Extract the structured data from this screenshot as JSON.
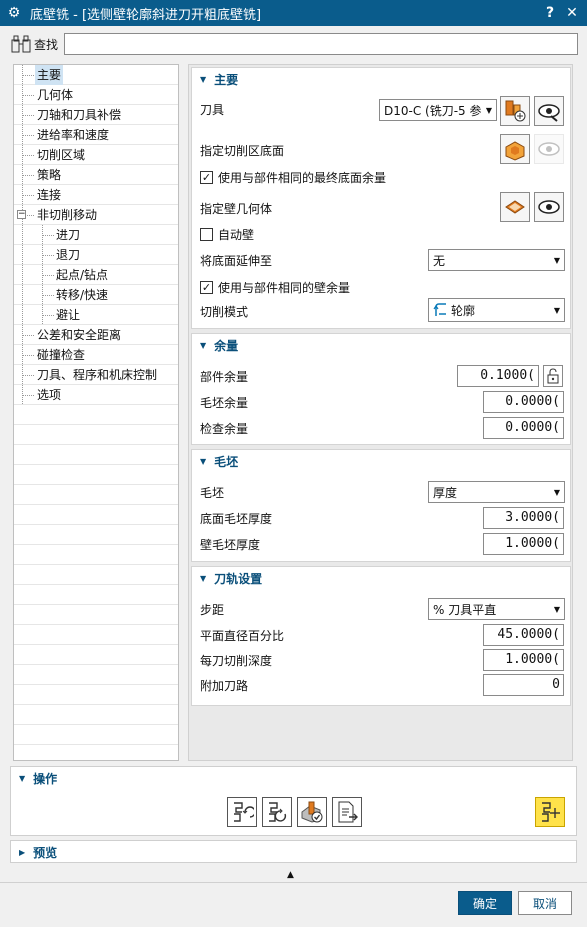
{
  "window": {
    "title": "底壁铣 - [选侧壁轮廓斜进刀开粗底壁铣]",
    "help_label": "?",
    "close_label": "✕"
  },
  "find": {
    "label": "查找",
    "value": ""
  },
  "tree": {
    "items": [
      {
        "label": "主要",
        "level": 0,
        "selected": true
      },
      {
        "label": "几何体",
        "level": 0
      },
      {
        "label": "刀轴和刀具补偿",
        "level": 0
      },
      {
        "label": "进给率和速度",
        "level": 0
      },
      {
        "label": "切削区域",
        "level": 0
      },
      {
        "label": "策略",
        "level": 0
      },
      {
        "label": "连接",
        "level": 0
      },
      {
        "label": "非切削移动",
        "level": 0,
        "expander": "−"
      },
      {
        "label": "进刀",
        "level": 1
      },
      {
        "label": "退刀",
        "level": 1
      },
      {
        "label": "起点/钻点",
        "level": 1
      },
      {
        "label": "转移/快速",
        "level": 1
      },
      {
        "label": "避让",
        "level": 1
      },
      {
        "label": "公差和安全距离",
        "level": 0
      },
      {
        "label": "碰撞检查",
        "level": 0
      },
      {
        "label": "刀具、程序和机床控制",
        "level": 0
      },
      {
        "label": "选项",
        "level": 0
      }
    ]
  },
  "main_group": {
    "header": "主要",
    "tool_label": "刀具",
    "tool_value": "D10-C (铣刀-5 参",
    "floor_label": "指定切削区底面",
    "use_floor_stock_label": "使用与部件相同的最终底面余量",
    "use_floor_stock_checked": "✓",
    "wall_geom_label": "指定壁几何体",
    "auto_wall_label": "自动壁",
    "auto_wall_checked": "",
    "extend_label": "将底面延伸至",
    "extend_value": "无",
    "use_wall_stock_label": "使用与部件相同的壁余量",
    "use_wall_stock_checked": "✓",
    "cut_pattern_label": "切削模式",
    "cut_pattern_value": "轮廓"
  },
  "stock_group": {
    "header": "余量",
    "part_label": "部件余量",
    "part_value": "0.1000(",
    "blank_label": "毛坯余量",
    "blank_value": "0.0000(",
    "check_label": "检查余量",
    "check_value": "0.0000("
  },
  "blank_group": {
    "header": "毛坯",
    "blank_label": "毛坯",
    "blank_value": "厚度",
    "floor_thick_label": "底面毛坯厚度",
    "floor_thick_value": "3.0000(",
    "wall_thick_label": "壁毛坯厚度",
    "wall_thick_value": "1.0000("
  },
  "path_group": {
    "header": "刀轨设置",
    "step_label": "步距",
    "step_value": "% 刀具平直",
    "percent_label": "平面直径百分比",
    "percent_value": "45.0000(",
    "depth_label": "每刀切削深度",
    "depth_value": "1.0000(",
    "extra_label": "附加刀路",
    "extra_value": "0"
  },
  "operations": {
    "header": "操作"
  },
  "preview": {
    "header": "预览"
  },
  "buttons": {
    "ok": "确定",
    "cancel": "取消"
  },
  "colors": {
    "title_bar": "#0a5c8c",
    "accent": "#0a4f7a",
    "highlight": "#ffe24a"
  }
}
